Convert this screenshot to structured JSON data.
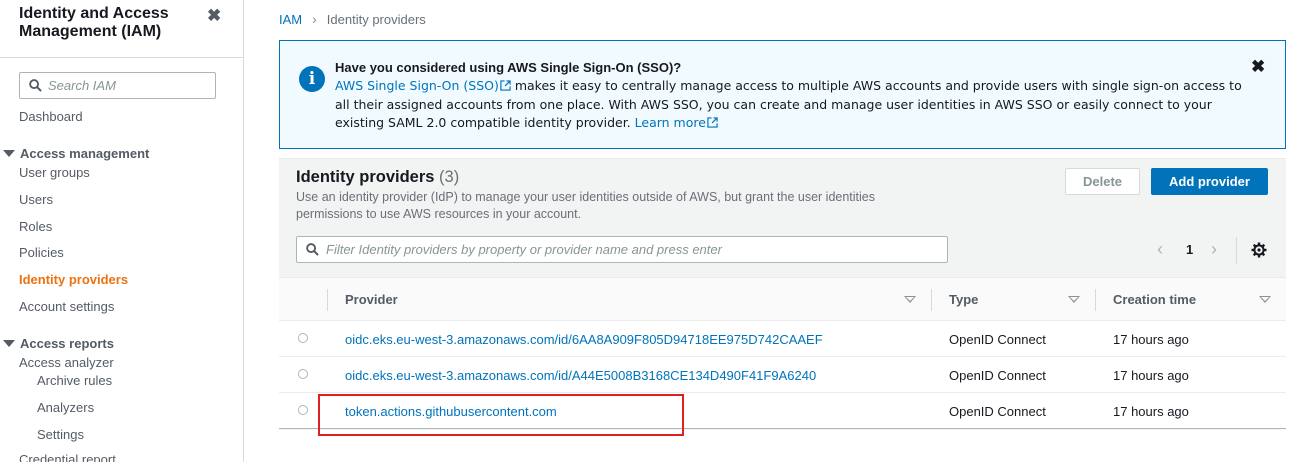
{
  "sidebar": {
    "title": "Identity and Access Management (IAM)",
    "search_placeholder": "Search IAM",
    "dashboard": "Dashboard",
    "access_management": {
      "label": "Access management",
      "items": [
        "User groups",
        "Users",
        "Roles",
        "Policies",
        "Identity providers",
        "Account settings"
      ],
      "active": "Identity providers"
    },
    "access_reports": {
      "label": "Access reports",
      "items": [
        "Access analyzer",
        "Archive rules",
        "Analyzers",
        "Settings",
        "Credential report"
      ]
    }
  },
  "breadcrumb": {
    "root": "IAM",
    "current": "Identity providers"
  },
  "flash": {
    "title": "Have you considered using AWS Single Sign-On (SSO)?",
    "link1": "AWS Single Sign-On (SSO)",
    "text1": " makes it easy to centrally manage access to multiple AWS accounts and provide users with single sign-on access to all their assigned accounts from one place. With AWS SSO, you can create and manage user identities in AWS SSO or easily connect to your existing SAML 2.0 compatible identity provider. ",
    "link2": "Learn more"
  },
  "panel": {
    "title": "Identity providers",
    "count": "(3)",
    "description": "Use an identity provider (IdP) to manage your user identities outside of AWS, but grant the user identities permissions to use AWS resources in your account.",
    "delete_label": "Delete",
    "add_label": "Add provider",
    "filter_placeholder": "Filter Identity providers by property or provider name and press enter",
    "page": "1"
  },
  "table": {
    "columns": [
      "Provider",
      "Type",
      "Creation time"
    ],
    "rows": [
      {
        "provider": "oidc.eks.eu-west-3.amazonaws.com/id/6AA8A909F805D94718EE975D742CAAEF",
        "type": "OpenID Connect",
        "created": "17 hours ago"
      },
      {
        "provider": "oidc.eks.eu-west-3.amazonaws.com/id/A44E5008B3168CE134D490F41F9A6240",
        "type": "OpenID Connect",
        "created": "17 hours ago"
      },
      {
        "provider": "token.actions.githubusercontent.com",
        "type": "OpenID Connect",
        "created": "17 hours ago"
      }
    ]
  },
  "colors": {
    "accent": "#0073bb",
    "active_nav": "#ec7211",
    "highlight": "#e02020"
  },
  "icons": [
    "close-icon",
    "search-icon",
    "caret-down-icon",
    "info-icon",
    "external-link-icon",
    "chevron-left-icon",
    "chevron-right-icon",
    "gear-icon",
    "sort-icon"
  ]
}
